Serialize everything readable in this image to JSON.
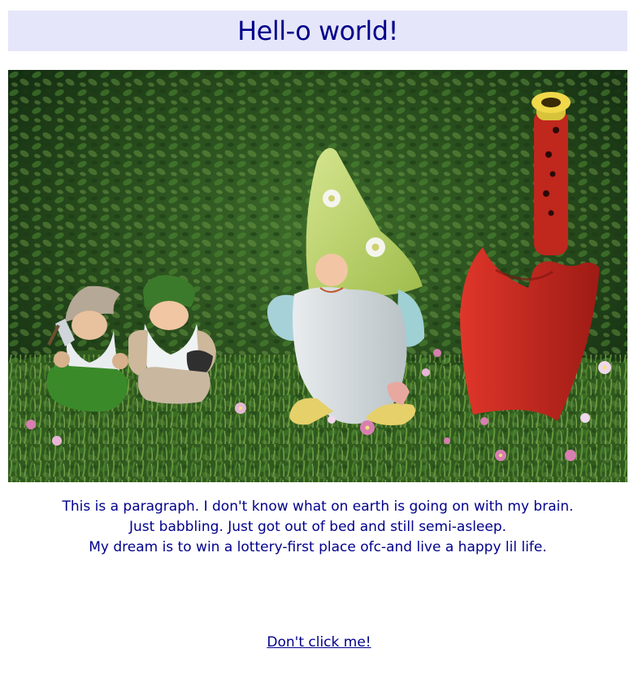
{
  "header": {
    "title": "Hell-o world!"
  },
  "image": {
    "subject": "garden gnome figurines and red garden trowel on green hedge"
  },
  "paragraph": {
    "lines": [
      "This is a paragraph. I don't know what on earth is going on with my brain.",
      "Just babbling. Just got out of bed and still semi-asleep.",
      "My dream is to win a lottery-first place ofc-and live a happy lil life."
    ]
  },
  "link": {
    "label": "Don't click me!"
  },
  "colors": {
    "text": "#00008b",
    "header_bg": "#e6e6fa"
  }
}
